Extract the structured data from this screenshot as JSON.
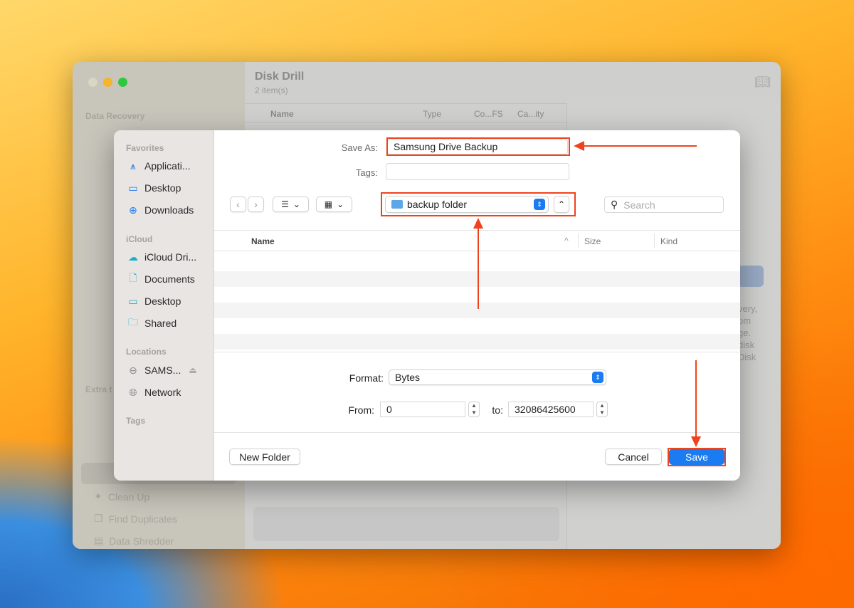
{
  "app": {
    "title": "Disk Drill",
    "subtitle": "2 item(s)",
    "section_data_recovery": "Data Recovery",
    "section_extra": "Extra t",
    "columns": [
      "Name",
      "Type",
      "Co...FS",
      "Ca...ity"
    ],
    "tools": [
      "Clean Up",
      "Find Duplicates",
      "Data Shredder"
    ],
    "right_panel_fragments": [
      "very,",
      "om",
      "ge.",
      "disk",
      "Disk"
    ]
  },
  "dialog": {
    "sidebar": {
      "favorites_label": "Favorites",
      "favorites": [
        "Applicati...",
        "Desktop",
        "Downloads"
      ],
      "icloud_label": "iCloud",
      "icloud": [
        "iCloud Dri...",
        "Documents",
        "Desktop",
        "Shared"
      ],
      "locations_label": "Locations",
      "locations": [
        "SAMS...",
        "Network"
      ],
      "tags_label": "Tags"
    },
    "save_as_label": "Save As:",
    "save_as_value": "Samsung Drive Backup",
    "tags_label": "Tags:",
    "tags_value": "",
    "folder": "backup folder",
    "search_placeholder": "Search",
    "columns": [
      "Name",
      "Size",
      "Kind"
    ],
    "format_label": "Format:",
    "format_value": "Bytes",
    "from_label": "From:",
    "from_value": "0",
    "to_label": "to:",
    "to_value": "32086425600",
    "new_folder": "New Folder",
    "cancel": "Cancel",
    "save": "Save"
  },
  "colors": {
    "accent": "#1a7cf0",
    "annotation": "#f0421c"
  }
}
